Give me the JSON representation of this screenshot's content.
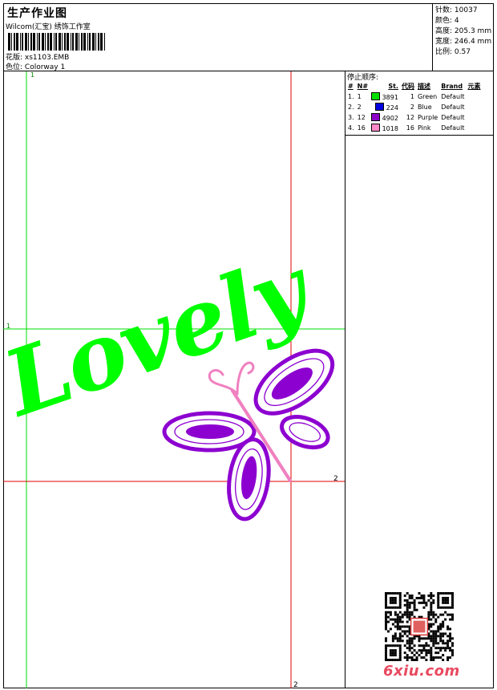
{
  "header": {
    "title": "生产作业图",
    "subtitle": "Wilcom(汇宝) 绣饰工作室",
    "design_label": "花版:",
    "design_value": "xs1103.EMB",
    "colorway_label": "色位:",
    "colorway_value": "Colorway 1"
  },
  "stats": {
    "stitches_label": "针数:",
    "stitches_value": "10037",
    "colors_label": "颜色:",
    "colors_value": "4",
    "height_label": "高度:",
    "height_value": "205.3 mm",
    "width_label": "宽度:",
    "width_value": "246.4 mm",
    "scale_label": "比例:",
    "scale_value": "0.57"
  },
  "stop_sequence": {
    "title": "停止顺序:",
    "columns": [
      "#",
      "N#",
      "St.",
      "代码",
      "描述",
      "Brand",
      "元素"
    ],
    "rows": [
      {
        "idx": "1.",
        "n": "1",
        "st": "3891",
        "code": "1",
        "desc": "Green",
        "brand": "Default",
        "color": "#00e000"
      },
      {
        "idx": "2.",
        "n": "2",
        "st": "224",
        "code": "2",
        "desc": "Blue",
        "brand": "Default",
        "color": "#0000e0"
      },
      {
        "idx": "3.",
        "n": "12",
        "st": "4902",
        "code": "12",
        "desc": "Purple",
        "brand": "Default",
        "color": "#8c00c8"
      },
      {
        "idx": "4.",
        "n": "16",
        "st": "1018",
        "code": "16",
        "desc": "Pink",
        "brand": "Default",
        "color": "#ff88c8"
      }
    ]
  },
  "design": {
    "text": "Lovely",
    "text_color": "#00ff00",
    "butterfly_color": "#8c00d0",
    "antenna_color": "#f080c0",
    "guide_green": "#00dd00",
    "guide_red": "#e00000",
    "marker_green_top": "1",
    "marker_green_left": "1",
    "marker_red_right": "2",
    "marker_red_bottom": "2"
  },
  "footer": {
    "brand": "6xiu.com",
    "brand_color": "#e84a60"
  }
}
